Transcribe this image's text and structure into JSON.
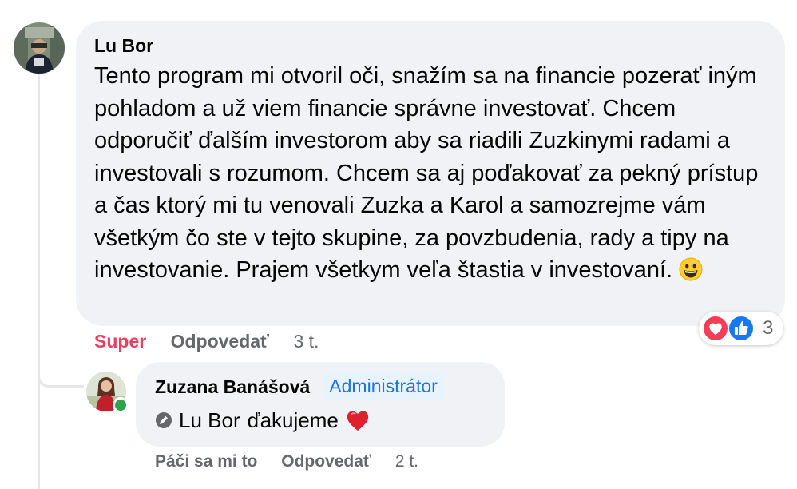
{
  "top_fragment": "",
  "comment": {
    "author": "Lu Bor",
    "text": "Tento program mi otvoril oči, snažím sa na financie pozerať iným pohladom a už viem financie správne investovať. Chcem odporučiť ďalším investorom aby sa riadili Zuzkinymi radami a investovali s rozumom. Chcem sa aj poďakovať za pekný prístup a čas ktorý mi tu venovali Zuzka a Karol a samozrejme vám všetkým čo ste v tejto skupine, za povzbudenia, rady a tipy na investovanie. Prajem všetkym veľa štastia v investovaní.",
    "emoji": "grinning-face-icon",
    "reactions": {
      "icons": [
        "love-reaction-icon",
        "like-reaction-icon"
      ],
      "count": "3"
    },
    "actions": {
      "reaction_label": "Super",
      "reply_label": "Odpovedať",
      "time": "3 t."
    }
  },
  "reply": {
    "author": "Zuzana Banášová",
    "badge": "Administrátor",
    "mention": "Lu Bor",
    "text": "ďakujeme",
    "emoji": "red-heart-icon",
    "actions": {
      "like_label": "Páči sa mi to",
      "reply_label": "Odpovedať",
      "time": "2 t."
    }
  },
  "colors": {
    "bubble": "#f0f2f5",
    "super_red": "#e4405f",
    "badge_blue": "#1b74e4",
    "badge_bg": "#e7f3ff",
    "online_green": "#31a24c",
    "muted": "#65676b"
  }
}
